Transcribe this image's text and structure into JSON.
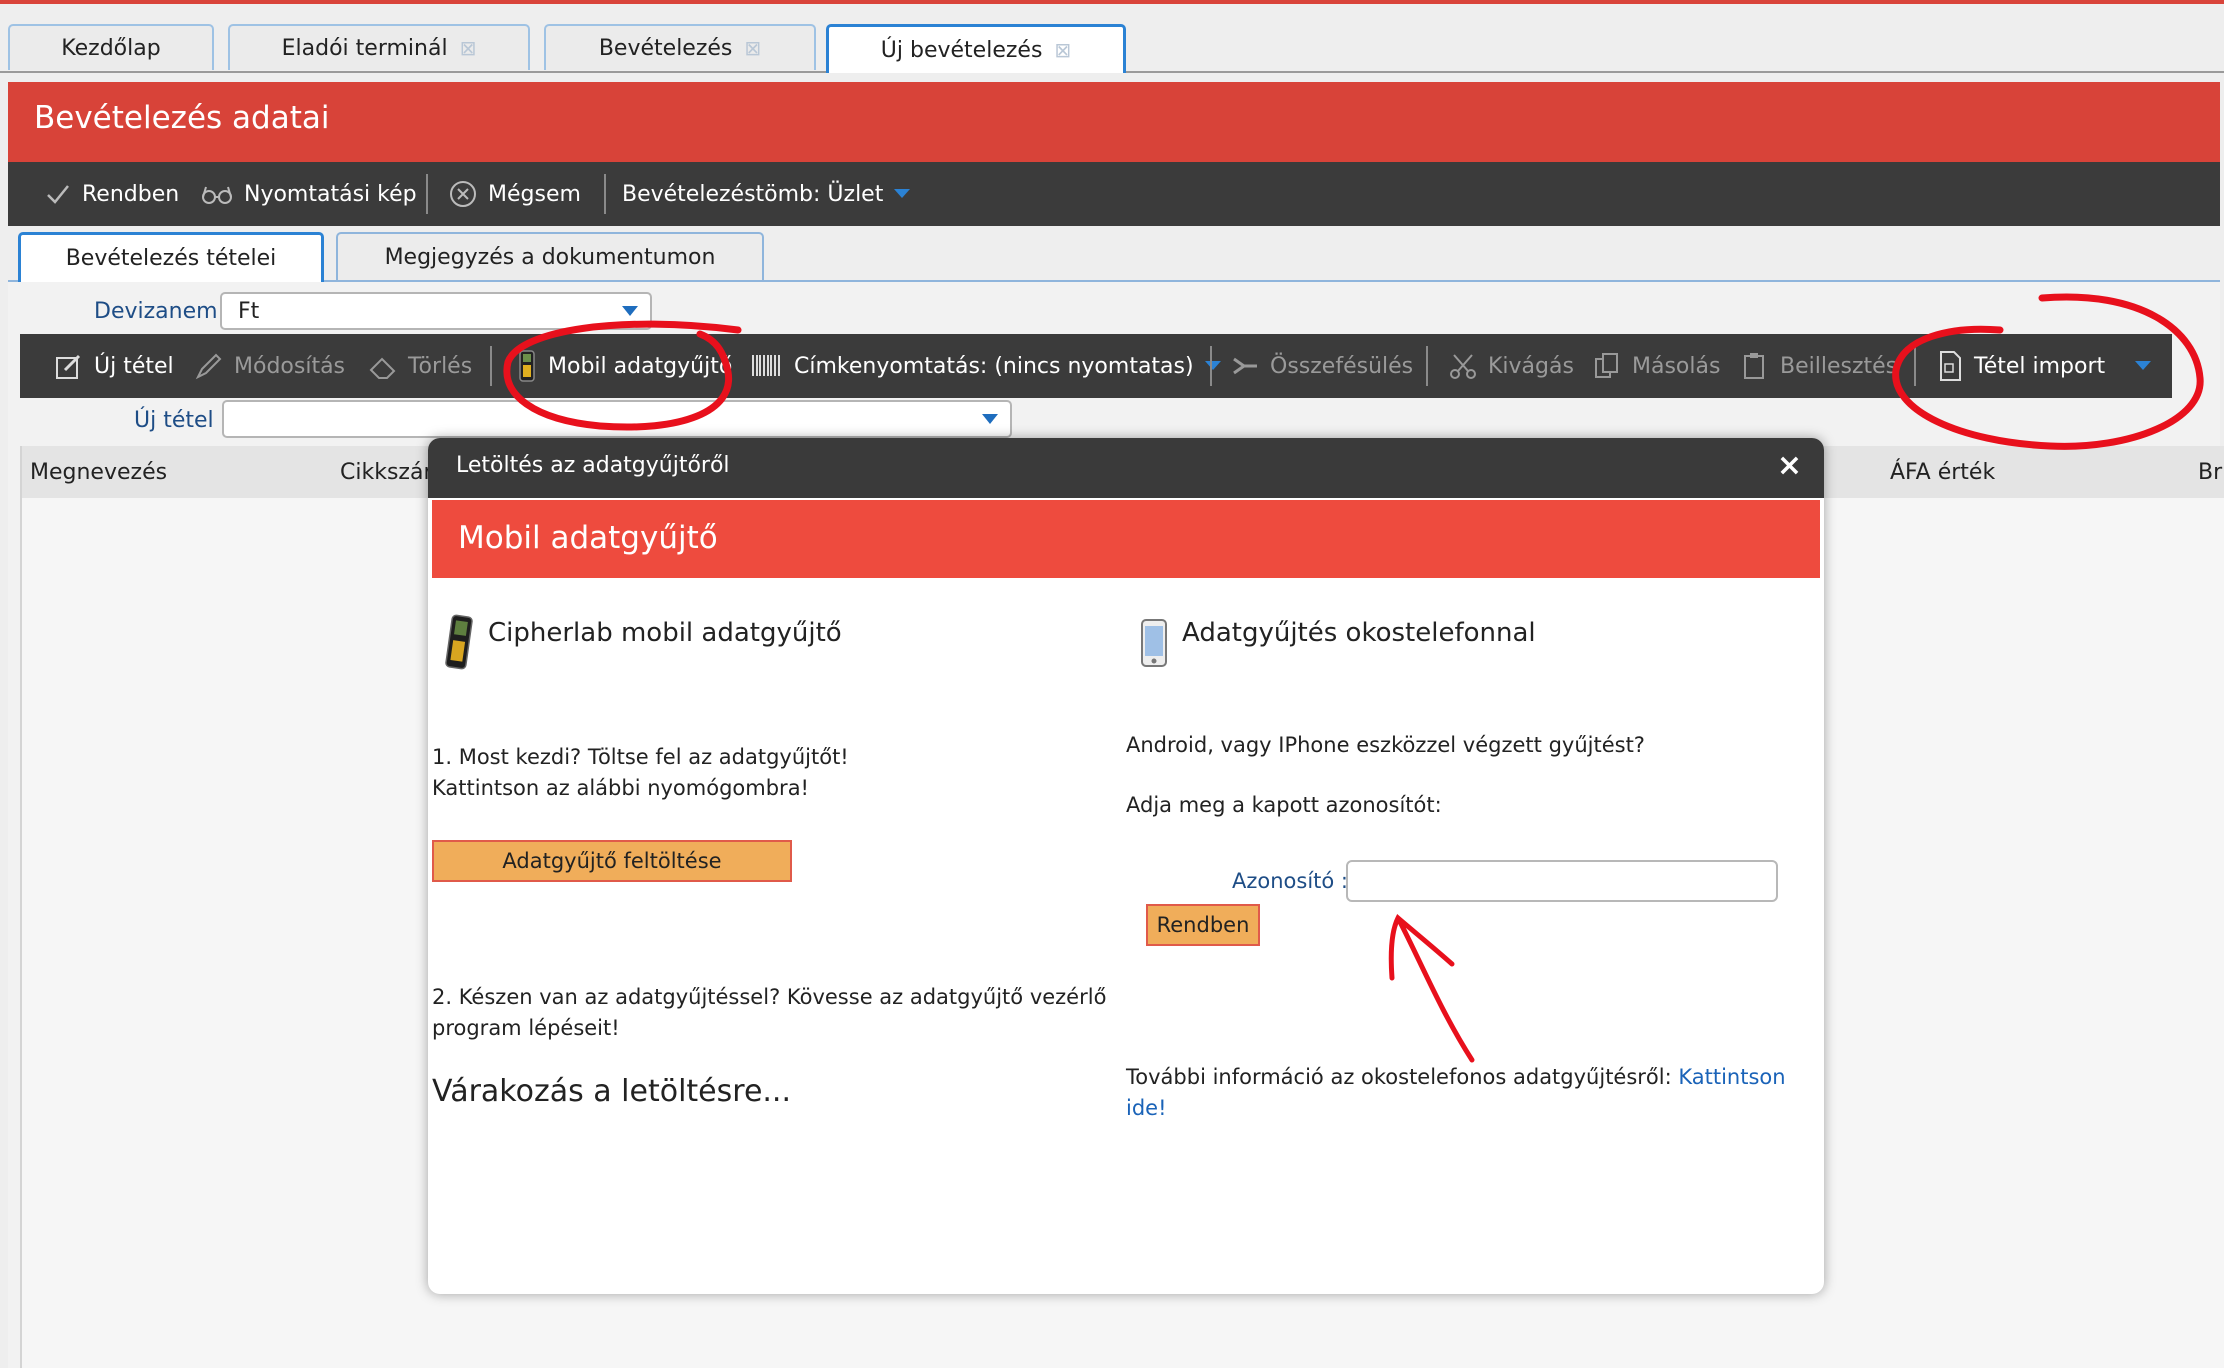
{
  "tabs": [
    {
      "label": "Kezdőlap",
      "closable": false
    },
    {
      "label": "Eladói terminál",
      "closable": true
    },
    {
      "label": "Bevételezés",
      "closable": true
    },
    {
      "label": "Új bevételezés",
      "closable": true,
      "active": true
    }
  ],
  "close_glyph": "⊠",
  "header": {
    "title": "Bevételezés adatai"
  },
  "toolbar": {
    "ok": "Rendben",
    "print": "Nyomtatási kép",
    "cancel": "Mégsem",
    "block": "Bevételezéstömb: Üzlet"
  },
  "subtabs": [
    "Bevételezés tételei",
    "Megjegyzés a dokumentumon"
  ],
  "currency": {
    "label": "Devizanem :",
    "value": "Ft"
  },
  "items_toolbar": {
    "new": "Új tétel",
    "edit": "Módosítás",
    "delete": "Törlés",
    "mobile": "Mobil adatgyűjtő",
    "label_print": "Címkenyomtatás: (nincs nyomtatas)",
    "merge": "Összefésülés",
    "cut": "Kivágás",
    "copy": "Másolás",
    "paste": "Beillesztés",
    "import": "Tétel import"
  },
  "new_item": {
    "label": "Új tétel :",
    "value": ""
  },
  "grid_headers": {
    "name": "Megnevezés",
    "sku": "Cikkszám",
    "vat": "ÁFA érték",
    "gross": "Br"
  },
  "dialog": {
    "title": "Letöltés az adatgyűjtőről",
    "close": "×",
    "heading": "Mobil adatgyűjtő",
    "left": {
      "title": "Cipherlab mobil adatgyűjtő",
      "step1_line1": "1. Most kezdi? Töltse fel az adatgyűjtőt!",
      "step1_line2": "Kattintson az alábbi nyomógombra!",
      "upload_button": "Adatgyűjtő feltöltése",
      "step2_line1": "2. Készen van az adatgyűjtéssel? Kövesse az adatgyűjtő vezérlő",
      "step2_line2": "program lépéseit!",
      "waiting": "Várakozás a letöltésre..."
    },
    "right": {
      "title": "Adatgyűjtés okostelefonnal",
      "question": "Android, vagy IPhone eszközzel végzett gyűjtést?",
      "prompt": "Adja meg a kapott azonosítót:",
      "id_label": "Azonosító :",
      "id_value": "",
      "ok_button": "Rendben",
      "info": "További információ az okostelefonos adatgyűjtésről: ",
      "info_link": "Kattintson ide!"
    }
  },
  "colors": {
    "header_red": "#d84339",
    "dialog_red": "#ee4b3e",
    "toolbar_dark": "#3b3b3b",
    "accent_blue": "#2b82d4",
    "button_orange": "#f0ad5a",
    "annotation_red": "#e8101c"
  }
}
